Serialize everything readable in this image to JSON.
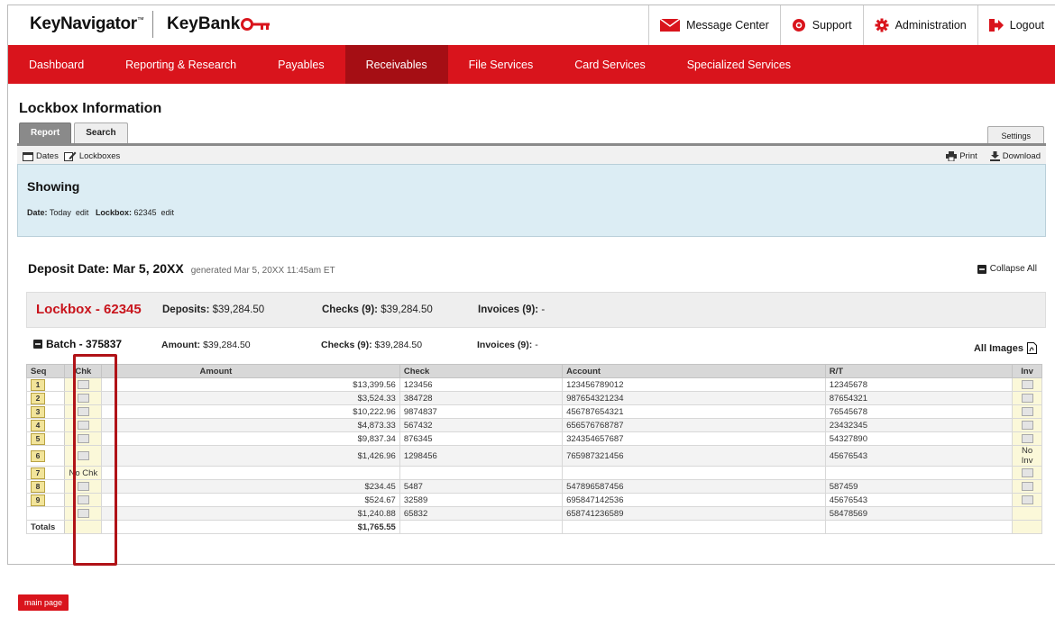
{
  "header": {
    "logo_keynavigator": "KeyNavigator",
    "logo_tm": "™",
    "logo_keybank": "KeyBank",
    "links": [
      {
        "label": "Message Center",
        "icon": "envelope-icon"
      },
      {
        "label": "Support",
        "icon": "support-icon"
      },
      {
        "label": "Administration",
        "icon": "gear-icon"
      },
      {
        "label": "Logout",
        "icon": "logout-icon"
      }
    ]
  },
  "nav": [
    "Dashboard",
    "Reporting & Research",
    "Payables",
    "Receivables",
    "File Services",
    "Card Services",
    "Specialized Services"
  ],
  "nav_active": "Receivables",
  "page": {
    "title": "Lockbox Information",
    "tabs": [
      "Report",
      "Search"
    ],
    "settings_tab": "Settings",
    "tools": {
      "dates": "Dates",
      "lockboxes": "Lockboxes",
      "print": "Print",
      "download": "Download"
    }
  },
  "showing": {
    "title": "Showing",
    "date_label": "Date:",
    "date_value": "Today",
    "edit1": "edit",
    "lockbox_label": "Lockbox:",
    "lockbox_value": "62345",
    "edit2": "edit"
  },
  "deposit": {
    "title": "Deposit Date: Mar 5, 20XX",
    "generated": "generated Mar 5, 20XX 11:45am ET",
    "collapse_all": "Collapse All"
  },
  "lockbox": {
    "name": "Lockbox - 62345",
    "deposits_label": "Deposits:",
    "deposits_value": "$39,284.50",
    "checks_label": "Checks (9):",
    "checks_value": "$39,284.50",
    "invoices_label": "Invoices (9):",
    "invoices_value": "-"
  },
  "batch": {
    "name": "Batch - 375837",
    "amount_label": "Amount:",
    "amount_value": "$39,284.50",
    "checks_label": "Checks (9):",
    "checks_value": "$39,284.50",
    "invoices_label": "Invoices (9):",
    "invoices_value": "-",
    "all_images": "All Images"
  },
  "table": {
    "columns": [
      "Seq",
      "Chk",
      "Amount",
      "Check",
      "Account",
      "R/T",
      "Inv"
    ],
    "rows": [
      {
        "seq": "1",
        "chk": "icon",
        "amount": "$13,399.56",
        "check": "123456",
        "account": "123456789012",
        "rt": "12345678",
        "inv": "icon"
      },
      {
        "seq": "2",
        "chk": "icon",
        "amount": "$3,524.33",
        "check": "384728",
        "account": "987654321234",
        "rt": "87654321",
        "inv": "icon"
      },
      {
        "seq": "3",
        "chk": "icon",
        "amount": "$10,222.96",
        "check": "9874837",
        "account": "456787654321",
        "rt": "76545678",
        "inv": "icon"
      },
      {
        "seq": "4",
        "chk": "icon",
        "amount": "$4,873.33",
        "check": "567432",
        "account": "656576768787",
        "rt": "23432345",
        "inv": "icon"
      },
      {
        "seq": "5",
        "chk": "icon",
        "amount": "$9,837.34",
        "check": "876345",
        "account": "324354657687",
        "rt": "54327890",
        "inv": "icon"
      },
      {
        "seq": "6",
        "chk": "icon",
        "amount": "$1,426.96",
        "check": "1298456",
        "account": "765987321456",
        "rt": "45676543",
        "inv": "No Inv"
      },
      {
        "seq": "7",
        "chk": "No Chk",
        "amount": "",
        "check": "",
        "account": "",
        "rt": "",
        "inv": "icon"
      },
      {
        "seq": "8",
        "chk": "icon",
        "amount": "$234.45",
        "check": "5487",
        "account": "547896587456",
        "rt": "587459",
        "inv": "icon"
      },
      {
        "seq": "9",
        "chk": "icon",
        "amount": "$524.67",
        "check": "32589",
        "account": "695847142536",
        "rt": "45676543",
        "inv": "icon"
      },
      {
        "seq": "",
        "chk": "icon",
        "amount": "$1,240.88",
        "check": "65832",
        "account": "658741236589",
        "rt": "58478569",
        "inv": ""
      }
    ],
    "totals_label": "Totals",
    "totals_amount": "$1,765.55"
  },
  "footer": {
    "main_page": "main page"
  },
  "colors": {
    "brand_red": "#d9141c",
    "active_nav": "#a50e14",
    "showing_bg": "#dcedf4",
    "highlight": "#b01217"
  }
}
